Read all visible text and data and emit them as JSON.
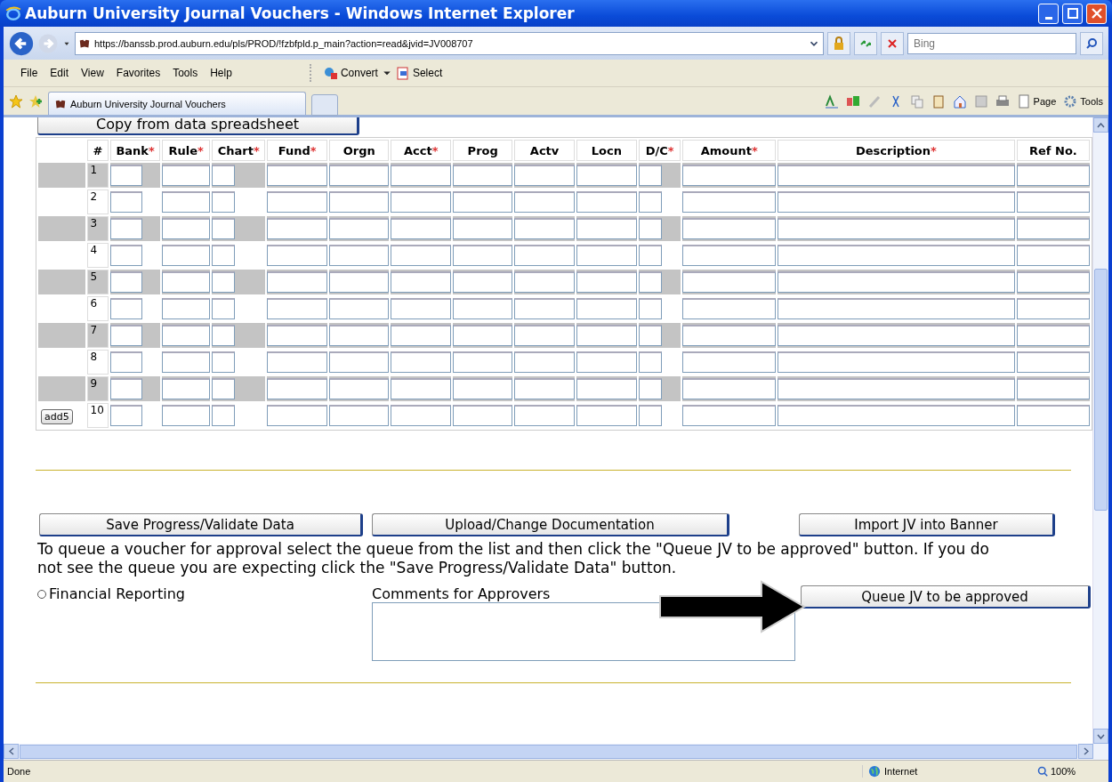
{
  "window": {
    "title": "Auburn University Journal Vouchers - Windows Internet Explorer"
  },
  "address_bar": {
    "url": "https://banssb.prod.auburn.edu/pls/PROD/!fzbfpld.p_main?action=read&jvid=JV008707",
    "search_placeholder": "Bing"
  },
  "menu": [
    "File",
    "Edit",
    "View",
    "Favorites",
    "Tools",
    "Help"
  ],
  "toolbar": [
    "Convert",
    "Select"
  ],
  "tab": {
    "title": "Auburn University Journal Vouchers"
  },
  "command_bar": [
    "Page",
    "Tools"
  ],
  "page": {
    "copy_button": "Copy from data spreadsheet",
    "columns": [
      {
        "label": "#"
      },
      {
        "label": "Bank",
        "required_mark": "*"
      },
      {
        "label": "Rule",
        "required_mark": "*"
      },
      {
        "label": "Chart",
        "required_mark": "*"
      },
      {
        "label": "Fund",
        "required_mark": "*"
      },
      {
        "label": "Orgn"
      },
      {
        "label": "Acct",
        "required_mark": "*"
      },
      {
        "label": "Prog"
      },
      {
        "label": "Actv"
      },
      {
        "label": "Locn"
      },
      {
        "label": "D/C",
        "required_mark": "*"
      },
      {
        "label": "Amount",
        "required_mark": "*"
      },
      {
        "label": "Description",
        "required_mark": "*"
      },
      {
        "label": "Ref No."
      }
    ],
    "rows": [
      {
        "number": "1",
        "shaded": true
      },
      {
        "number": "2",
        "shaded": false
      },
      {
        "number": "3",
        "shaded": true
      },
      {
        "number": "4",
        "shaded": false
      },
      {
        "number": "5",
        "shaded": true
      },
      {
        "number": "6",
        "shaded": false
      },
      {
        "number": "7",
        "shaded": true
      },
      {
        "number": "8",
        "shaded": false
      },
      {
        "number": "9",
        "shaded": true
      },
      {
        "number": "10",
        "shaded": false,
        "add_button": "add5"
      }
    ],
    "buttons": [
      "Save Progress/Validate Data",
      "Upload/Change Documentation",
      "Import JV into Banner"
    ],
    "instructions": "To queue a voucher for approval select the queue from the list and then click the \"Queue JV to be approved\" button. If you do not see the queue you are expecting click the \"Save Progress/Validate Data\" button.",
    "queue_options": [
      {
        "label": "Financial Reporting",
        "selected": false
      }
    ],
    "comments_label": "Comments for Approvers",
    "queue_button": "Queue JV to be approved"
  },
  "status_bar": {
    "text": "Done",
    "zone": "Internet",
    "zoom": "100%"
  }
}
